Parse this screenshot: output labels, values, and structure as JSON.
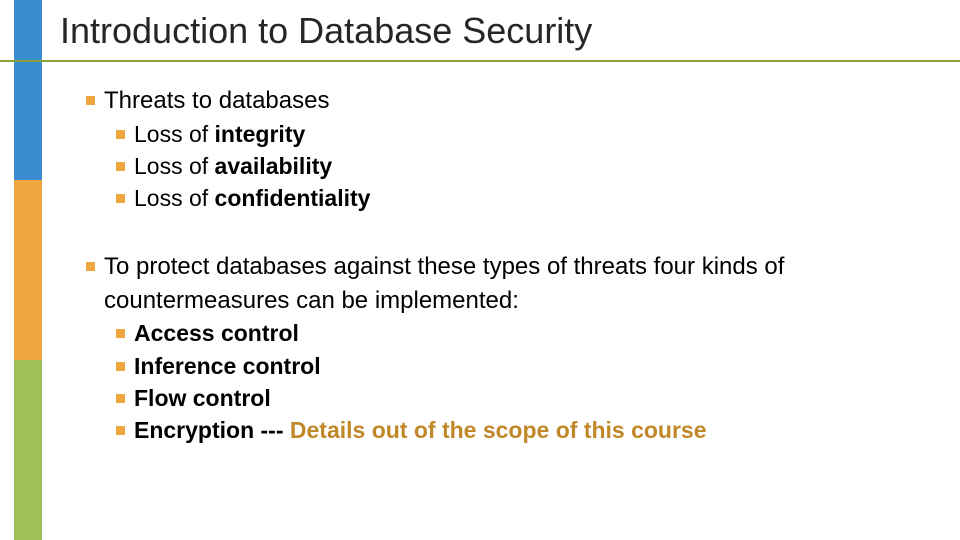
{
  "title": "Introduction to Database Security",
  "l1": "Threats to databases",
  "l1a_pre": "Loss of ",
  "l1a_bold": "integrity",
  "l1b_pre": "Loss of ",
  "l1b_bold": "availability",
  "l1c_pre": "Loss of ",
  "l1c_bold": "confidentiality",
  "l2": "To protect databases against these types of threats four kinds of countermeasures can be implemented:",
  "l2a": "Access control",
  "l2b": "Inference control",
  "l2c": "Flow control",
  "l2d_pre": "Encryption --- ",
  "l2d_hl": "Details out of the scope of this course"
}
